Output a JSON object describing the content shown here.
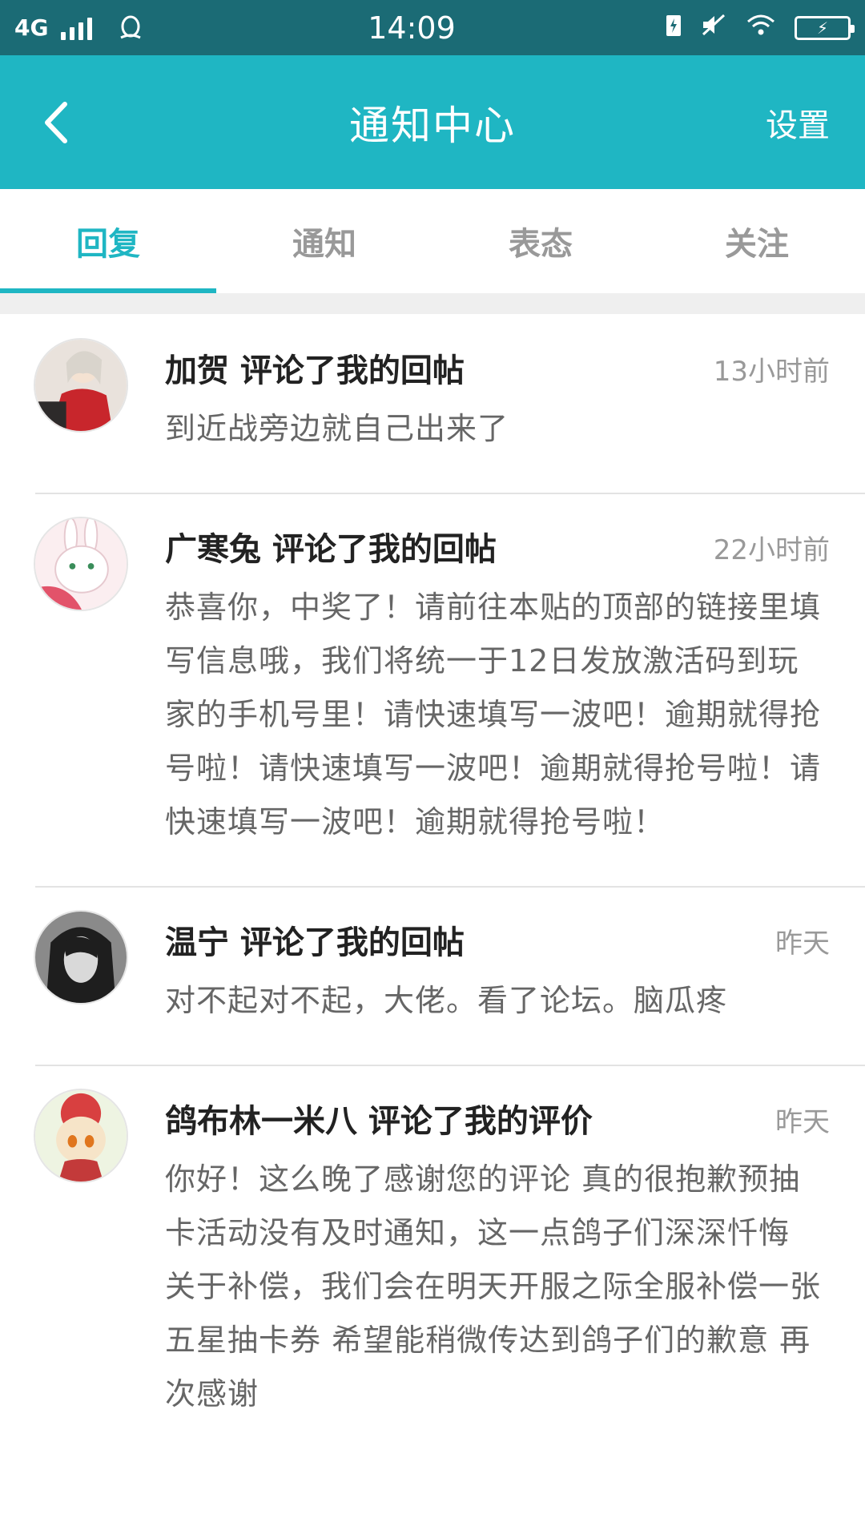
{
  "status_bar": {
    "network": "4G",
    "time": "14:09"
  },
  "app_bar": {
    "title": "通知中心",
    "settings_label": "设置"
  },
  "tabs": [
    {
      "label": "回复"
    },
    {
      "label": "通知"
    },
    {
      "label": "表态"
    },
    {
      "label": "关注"
    }
  ],
  "messages": [
    {
      "title": "加贺 评论了我的回帖",
      "time": "13小时前",
      "body": "到近战旁边就自己出来了"
    },
    {
      "title": "广寒兔 评论了我的回帖",
      "time": "22小时前",
      "body": "恭喜你，中奖了！请前往本贴的顶部的链接里填写信息哦，我们将统一于12日发放激活码到玩家的手机号里！请快速填写一波吧！逾期就得抢号啦！请快速填写一波吧！逾期就得抢号啦！请快速填写一波吧！逾期就得抢号啦！"
    },
    {
      "title": "温宁 评论了我的回帖",
      "time": "昨天",
      "body": "对不起对不起，大佬。看了论坛。脑瓜疼"
    },
    {
      "title": "鸽布林一米八 评论了我的评价",
      "time": "昨天",
      "body": "你好！这么晚了感谢您的评论 真的很抱歉预抽卡活动没有及时通知，这一点鸽子们深深忏悔 关于补偿，我们会在明天开服之际全服补偿一张五星抽卡券 希望能稍微传达到鸽子们的歉意 再次感谢"
    }
  ],
  "colors": {
    "status_bar": "#1b6b75",
    "accent": "#1fb6c3"
  }
}
